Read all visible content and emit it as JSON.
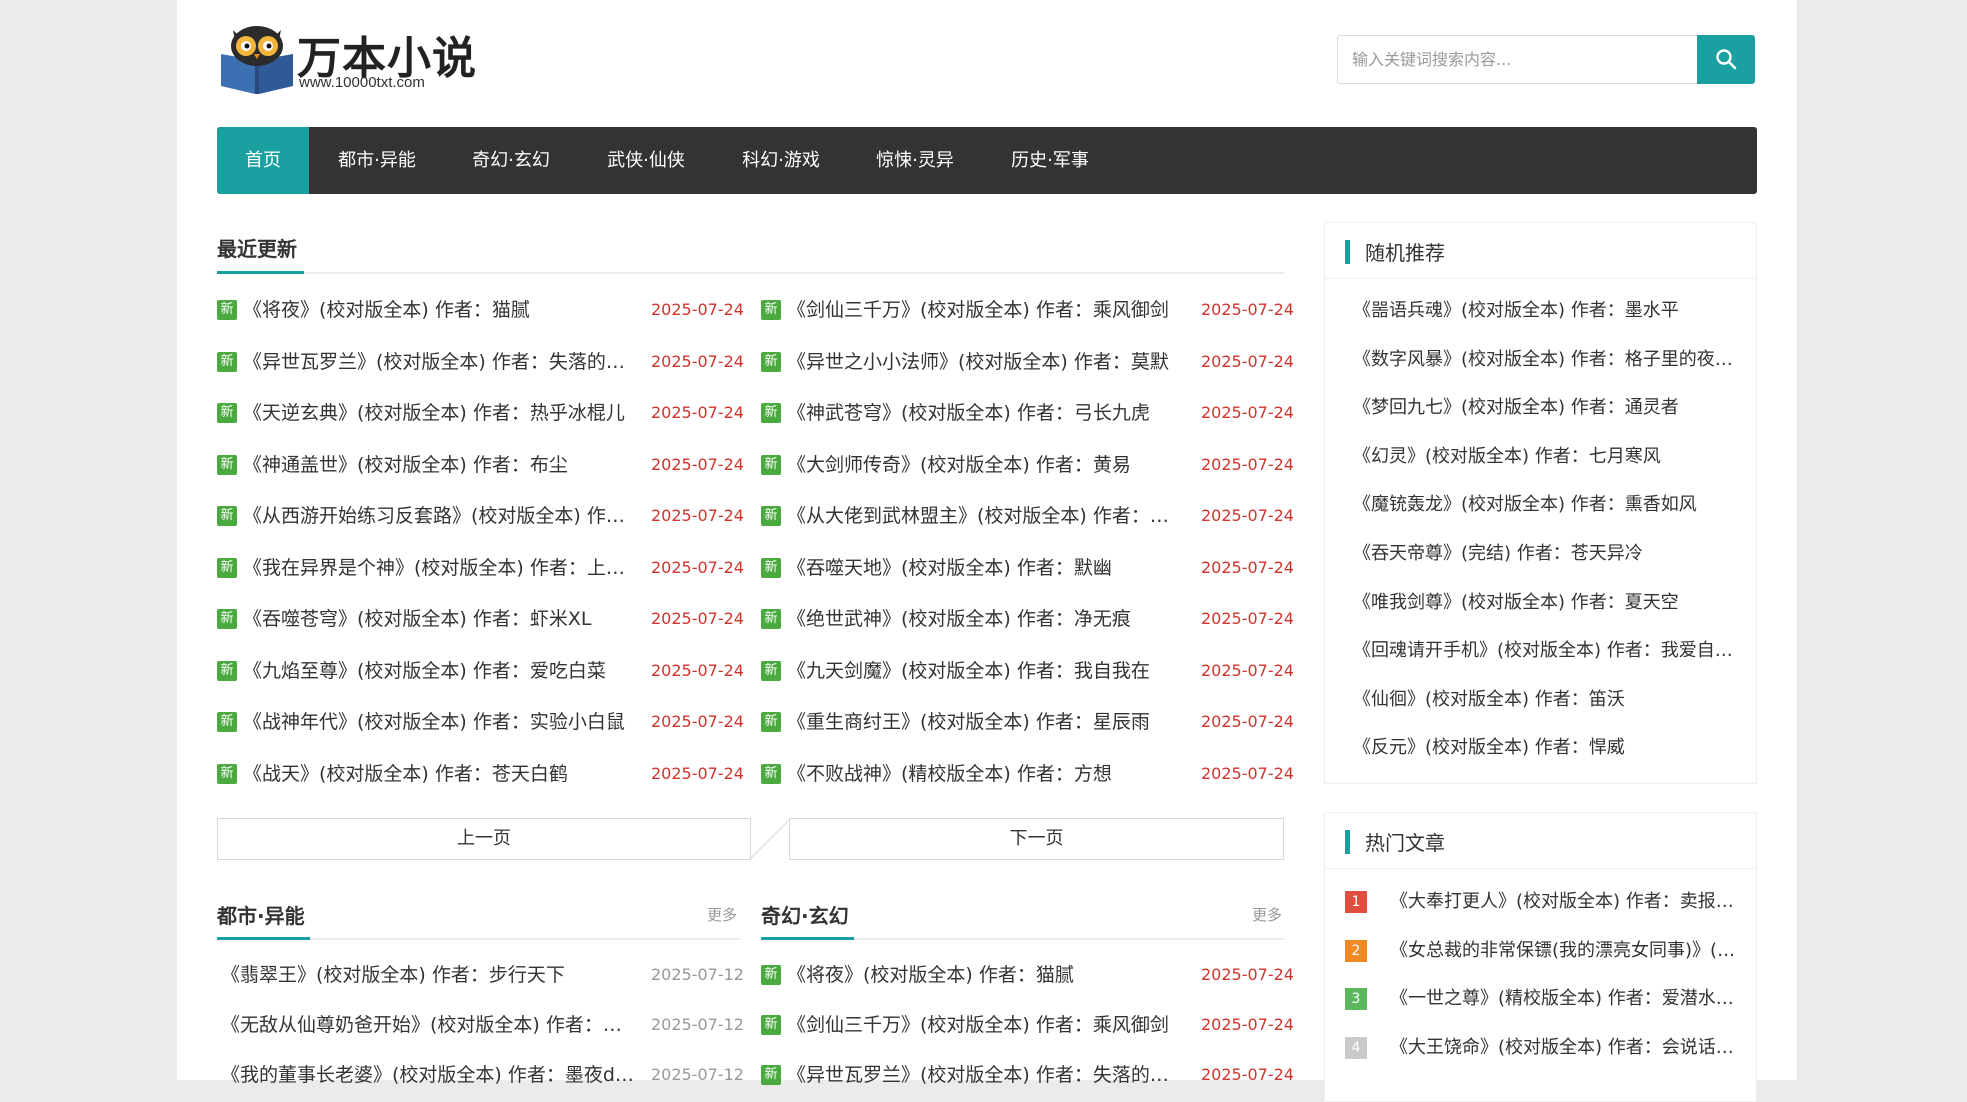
{
  "site": {
    "logo_text": "万本小说",
    "logo_url": "www.10000txt.com"
  },
  "search": {
    "placeholder": "输入关键词搜索内容..."
  },
  "nav": [
    "首页",
    "都市·异能",
    "奇幻·玄幻",
    "武侠·仙侠",
    "科幻·游戏",
    "惊悚·灵异",
    "历史·军事"
  ],
  "recent": {
    "title": "最近更新",
    "left": [
      {
        "badge": "新",
        "title": "《将夜》(校对版全本) 作者：猫腻",
        "date": "2025-07-24"
      },
      {
        "badge": "新",
        "title": "《异世瓦罗兰》(校对版全本) 作者：失落的…",
        "date": "2025-07-24"
      },
      {
        "badge": "新",
        "title": "《天逆玄典》(校对版全本) 作者：热乎冰棍儿",
        "date": "2025-07-24"
      },
      {
        "badge": "新",
        "title": "《神通盖世》(校对版全本) 作者：布尘",
        "date": "2025-07-24"
      },
      {
        "badge": "新",
        "title": "《从西游开始练习反套路》(校对版全本) 作…",
        "date": "2025-07-24"
      },
      {
        "badge": "新",
        "title": "《我在异界是个神》(校对版全本) 作者：上…",
        "date": "2025-07-24"
      },
      {
        "badge": "新",
        "title": "《吞噬苍穹》(校对版全本) 作者：虾米XL",
        "date": "2025-07-24"
      },
      {
        "badge": "新",
        "title": "《九焰至尊》(校对版全本) 作者：爱吃白菜",
        "date": "2025-07-24"
      },
      {
        "badge": "新",
        "title": "《战神年代》(校对版全本) 作者：实验小白鼠",
        "date": "2025-07-24"
      },
      {
        "badge": "新",
        "title": "《战天》(校对版全本) 作者：苍天白鹤",
        "date": "2025-07-24"
      }
    ],
    "right": [
      {
        "badge": "新",
        "title": "《剑仙三千万》(校对版全本) 作者：乘风御剑",
        "date": "2025-07-24"
      },
      {
        "badge": "新",
        "title": "《异世之小小法师》(校对版全本) 作者：莫默",
        "date": "2025-07-24"
      },
      {
        "badge": "新",
        "title": "《神武苍穹》(校对版全本) 作者：弓长九虎",
        "date": "2025-07-24"
      },
      {
        "badge": "新",
        "title": "《大剑师传奇》(校对版全本) 作者：黄易",
        "date": "2025-07-24"
      },
      {
        "badge": "新",
        "title": "《从大佬到武林盟主》(校对版全本) 作者：…",
        "date": "2025-07-24"
      },
      {
        "badge": "新",
        "title": "《吞噬天地》(校对版全本) 作者：默幽",
        "date": "2025-07-24"
      },
      {
        "badge": "新",
        "title": "《绝世武神》(校对版全本) 作者：净无痕",
        "date": "2025-07-24"
      },
      {
        "badge": "新",
        "title": "《九天剑魔》(校对版全本) 作者：我自我在",
        "date": "2025-07-24"
      },
      {
        "badge": "新",
        "title": "《重生商纣王》(校对版全本) 作者：星辰雨",
        "date": "2025-07-24"
      },
      {
        "badge": "新",
        "title": "《不败战神》(精校版全本) 作者：方想",
        "date": "2025-07-24"
      }
    ]
  },
  "pager": {
    "prev": "上一页",
    "next": "下一页"
  },
  "cat_left": {
    "title": "都市·异能",
    "more": "更多",
    "items": [
      {
        "title": "《翡翠王》(校对版全本) 作者：步行天下",
        "date": "2025-07-12"
      },
      {
        "title": "《无敌从仙尊奶爸开始》(校对版全本) 作者：…",
        "date": "2025-07-12"
      },
      {
        "title": "《我的董事长老婆》(校对版全本) 作者：墨夜d…",
        "date": "2025-07-12"
      }
    ]
  },
  "cat_right": {
    "title": "奇幻·玄幻",
    "more": "更多",
    "items": [
      {
        "badge": "新",
        "title": "《将夜》(校对版全本) 作者：猫腻",
        "date": "2025-07-24"
      },
      {
        "badge": "新",
        "title": "《剑仙三千万》(校对版全本) 作者：乘风御剑",
        "date": "2025-07-24"
      },
      {
        "badge": "新",
        "title": "《异世瓦罗兰》(校对版全本) 作者：失落的…",
        "date": "2025-07-24"
      }
    ]
  },
  "random": {
    "title": "随机推荐",
    "items": [
      "《噐语兵魂》(校对版全本) 作者：墨水平",
      "《数字风暴》(校对版全本) 作者：格子里的夜…",
      "《梦回九七》(校对版全本) 作者：通灵者",
      "《幻灵》(校对版全本) 作者：七月寒风",
      "《魔铳轰龙》(校对版全本) 作者：熏香如风",
      "《吞天帝尊》(完结) 作者：苍天异冷",
      "《唯我剑尊》(校对版全本) 作者：夏天空",
      "《回魂请开手机》(校对版全本) 作者：我爱自…",
      "《仙徊》(校对版全本) 作者：笛沃",
      "《反元》(校对版全本) 作者：悍威"
    ]
  },
  "hot": {
    "title": "热门文章",
    "items": [
      {
        "rank": "1",
        "title": "《大奉打更人》(校对版全本) 作者：卖报…",
        "color": "#e04e3f"
      },
      {
        "rank": "2",
        "title": "《女总裁的非常保镖(我的漂亮女同事)》(…",
        "color": "#f08a24"
      },
      {
        "rank": "3",
        "title": "《一世之尊》(精校版全本) 作者：爱潜水…",
        "color": "#5cb85c"
      },
      {
        "rank": "4",
        "title": "《大王饶命》(校对版全本) 作者：会说话…",
        "color": "#c9c9c9"
      }
    ]
  },
  "colors": {
    "accent": "#1aa0a0",
    "nav_bg": "#333333",
    "date_red": "#d0342c",
    "badge_green": "#4aaa3f"
  }
}
